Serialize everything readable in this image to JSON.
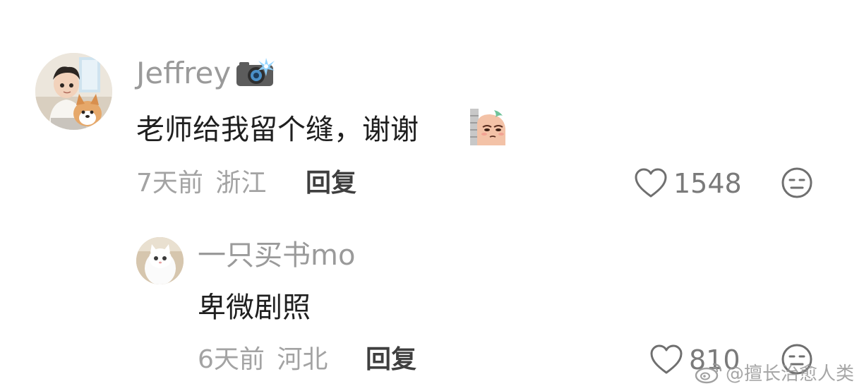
{
  "comments": [
    {
      "username": "Jeffrey",
      "badge_icon": "camera-flash-icon",
      "text": "老师给我留个缝，谢谢",
      "emoji_icon": "peeking-sausage-sticker-icon",
      "time": "7天前",
      "location": "浙江",
      "reply_label": "回复",
      "likes": "1548"
    },
    {
      "username": "一只买书mo",
      "text": "卑微剧照",
      "time": "6天前",
      "location": "河北",
      "reply_label": "回复",
      "likes": "810"
    }
  ],
  "watermark": {
    "text": "@擅长治愈人类",
    "icon": "weibo-logo-icon"
  },
  "colors": {
    "username": "#9a9a9a",
    "body": "#1f1f1f",
    "meta": "#a3a3a3",
    "reply": "#3f3f3f",
    "icon": "#6f6f6f"
  }
}
